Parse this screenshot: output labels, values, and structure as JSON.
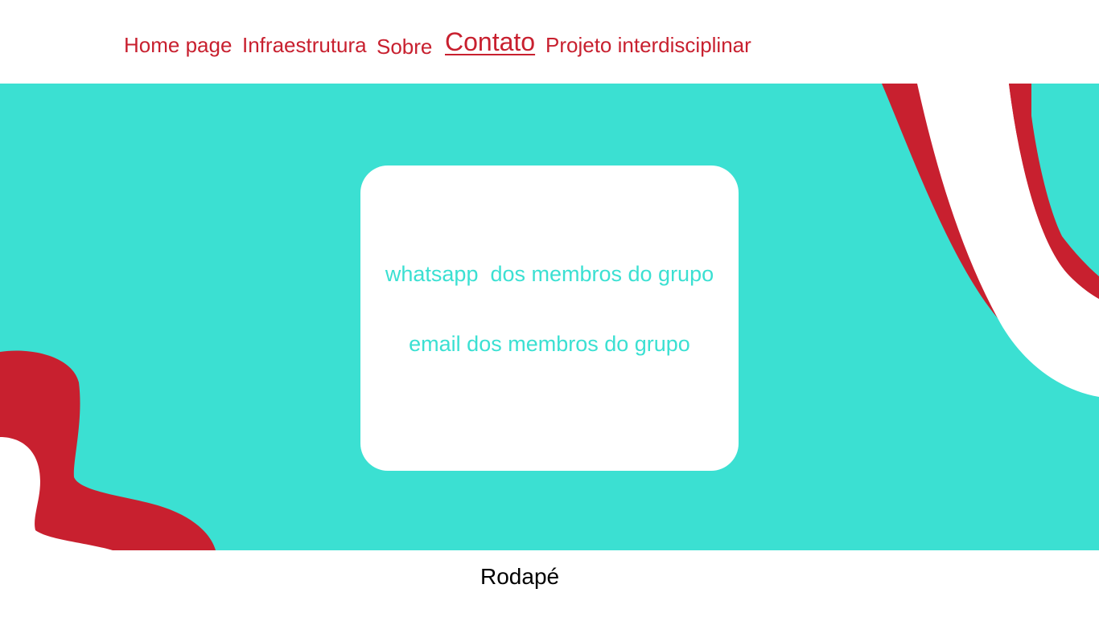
{
  "nav": {
    "items": [
      {
        "label": "Home page",
        "active": false
      },
      {
        "label": "Infraestrutura",
        "active": false
      },
      {
        "label": "Sobre",
        "active": false
      },
      {
        "label": "Contato",
        "active": true
      },
      {
        "label": "Projeto interdisciplinar",
        "active": false
      }
    ]
  },
  "contact_card": {
    "whatsapp_text": "whatsapp  dos membros do grupo",
    "email_text": "email dos membros do grupo"
  },
  "footer": {
    "text": "Rodapé"
  },
  "colors": {
    "brand_red": "#c8202f",
    "hero_teal": "#3be0d2",
    "card_background": "#ffffff",
    "footer_text": "#000000"
  }
}
